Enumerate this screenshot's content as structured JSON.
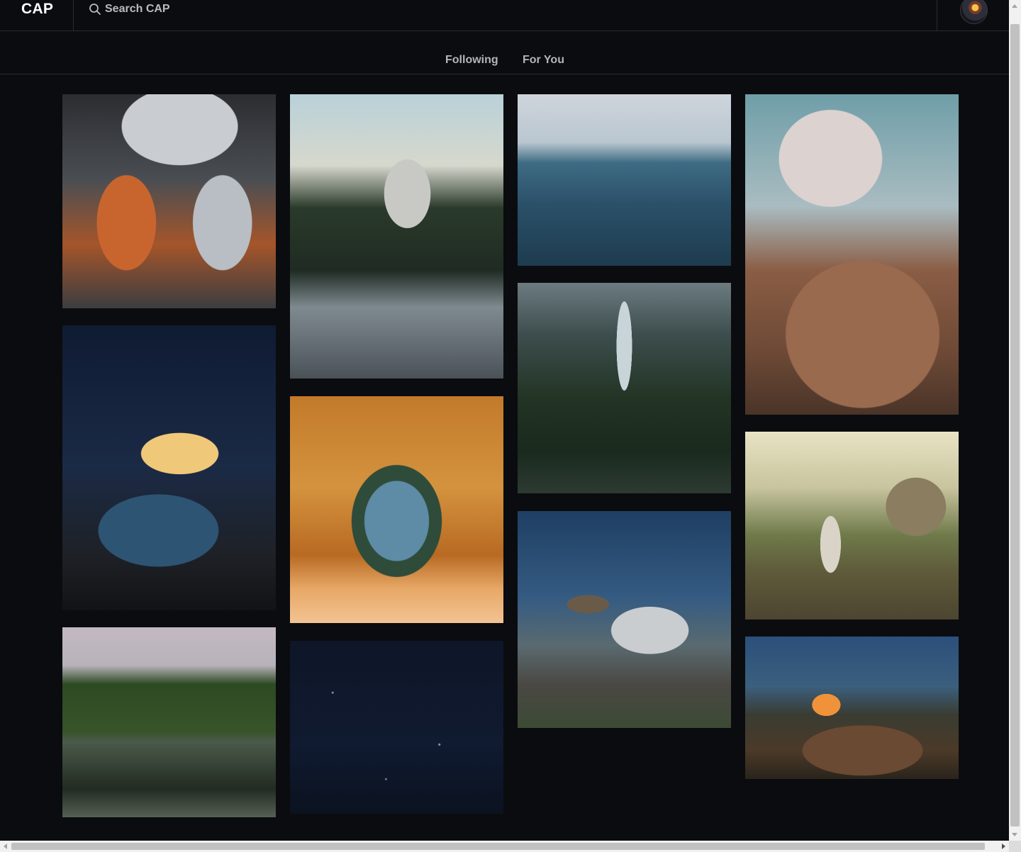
{
  "header": {
    "logo": "CAP",
    "search": {
      "placeholder": "Search CAP",
      "value": "",
      "icon": "search-icon"
    },
    "profile": {
      "icon": "avatar"
    }
  },
  "tabs": [
    {
      "label": "Following"
    },
    {
      "label": "For You"
    }
  ],
  "feed": {
    "columns": [
      [
        {
          "subject": "sleeping bag in car"
        },
        {
          "subject": "camper van at night"
        },
        {
          "subject": "canoe on lake"
        }
      ],
      [
        {
          "subject": "river in forest valley"
        },
        {
          "subject": "view from tent"
        },
        {
          "subject": "starry sky"
        }
      ],
      [
        {
          "subject": "ocean waves"
        },
        {
          "subject": "waterfall in pine forest"
        },
        {
          "subject": "vintage trailer at dusk"
        }
      ],
      [
        {
          "subject": "hiker on rocks"
        },
        {
          "subject": "campfire by tent"
        },
        {
          "subject": "friends around campfire"
        }
      ]
    ]
  },
  "colors": {
    "background": "#0b0c0f",
    "divider": "#2a2b2f",
    "text_muted": "#b3b5ba"
  }
}
